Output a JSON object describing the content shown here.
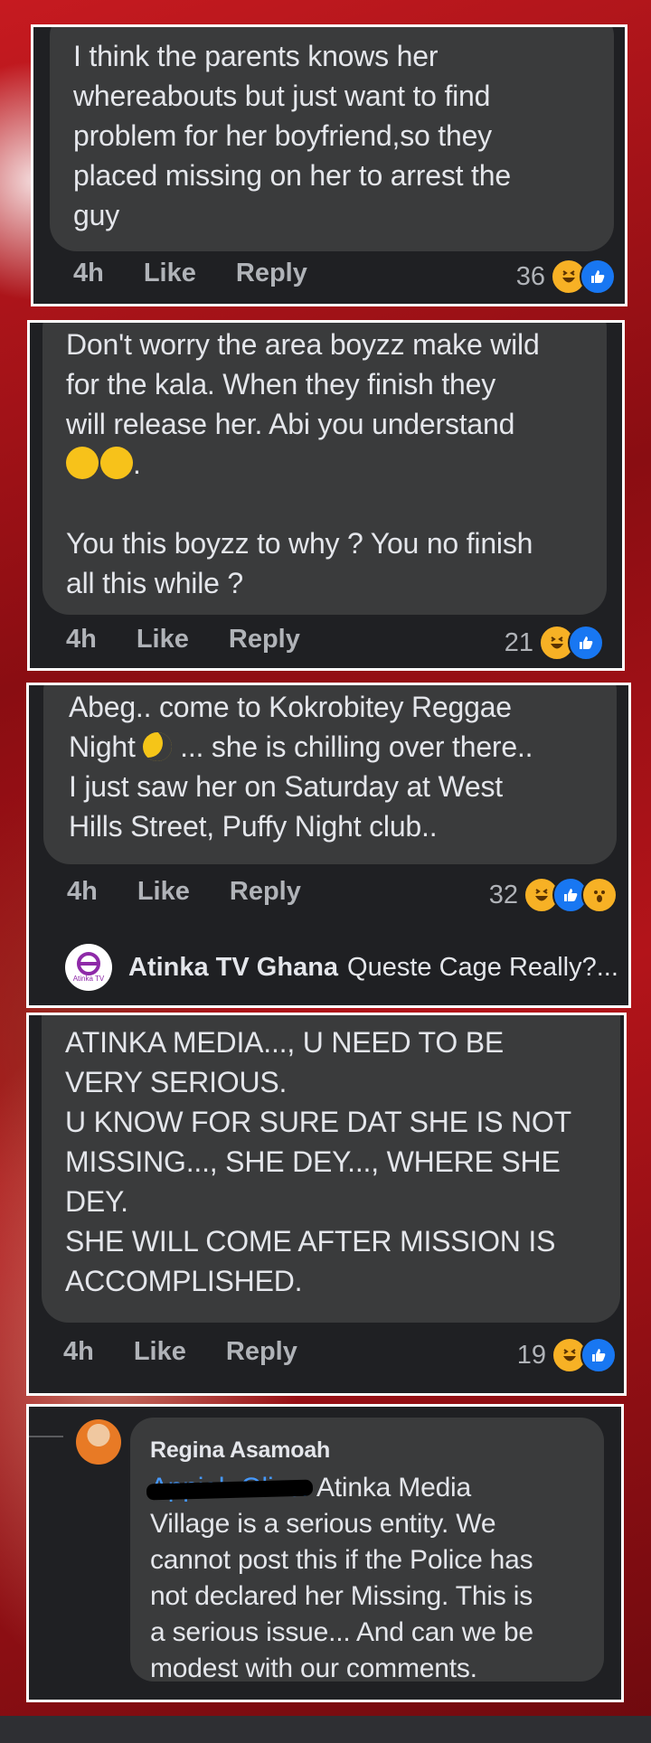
{
  "comments": [
    {
      "lines": [
        "I think the parents knows her",
        "whereabouts but just want to find",
        "problem for her boyfriend,so they",
        "placed missing on her to arrest the",
        "guy"
      ],
      "time": "4h",
      "like": "Like",
      "reply": "Reply",
      "count": "36",
      "reactions": [
        "haha-icon",
        "like-icon"
      ]
    },
    {
      "lines": [
        "Don't worry the area boyzz make wild",
        "for the kala. When they finish they",
        "will release her. Abi you understand",
        ".",
        "",
        "You this boyzz to why ? You no finish",
        "all this while ?"
      ],
      "time": "4h",
      "like": "Like",
      "reply": "Reply",
      "count": "21",
      "reactions": [
        "haha-icon",
        "like-icon"
      ]
    },
    {
      "lines": [
        "Abeg.. come to Kokrobitey Reggae",
        "... she is chilling over there..",
        "I just saw her on Saturday at West",
        "Hills Street,  Puffy Night club.."
      ],
      "line2_prefix": "Night",
      "time": "4h",
      "like": "Like",
      "reply": "Reply",
      "count": "32",
      "reactions": [
        "haha-icon",
        "like-icon",
        "wow-icon"
      ],
      "reply_preview": {
        "author": "Atinka TV Ghana",
        "text": "Queste Cage Really?...",
        "avatar_text": "Atinka TV"
      }
    },
    {
      "lines": [
        "ATINKA MEDIA..., U NEED TO BE",
        "VERY SERIOUS.",
        "U KNOW FOR SURE DAT SHE IS NOT",
        "MISSING..., SHE DEY..., WHERE SHE",
        "DEY.",
        "SHE WILL COME AFTER MISSION IS",
        "ACCOMPLISHED."
      ],
      "time": "4h",
      "like": "Like",
      "reply": "Reply",
      "count": "19",
      "reactions": [
        "haha-icon",
        "like-icon"
      ]
    },
    {
      "author": "Regina Asamoah",
      "mention": "Appiah Oliver",
      "lines": [
        "Atinka Media",
        "Village is a serious entity. We",
        "cannot post this if the Police has",
        "not declared her Missing. This is",
        "a serious issue... And can we be",
        "modest with our comments."
      ]
    }
  ],
  "colors": {
    "bubble": "#3a3b3c",
    "panel": "#1f2023",
    "text": "#e4e6eb",
    "meta": "#b0b3b8",
    "link": "#4599ff",
    "like_blue": "#1877f2",
    "haha_yellow": "#f7b125"
  }
}
